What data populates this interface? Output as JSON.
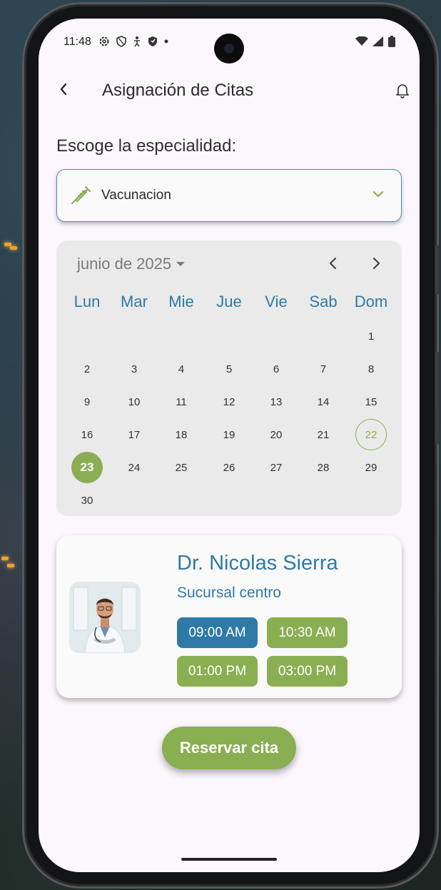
{
  "status_bar": {
    "time": "11:48",
    "icons": [
      "settings-icon",
      "shield-icon",
      "accessibility-icon",
      "shield-filled-icon",
      "dot-icon"
    ],
    "right_icons": [
      "wifi-icon",
      "signal-icon",
      "battery-icon"
    ]
  },
  "app_bar": {
    "title": "Asignación de Citas",
    "back_icon": "back-arrow-icon",
    "notification_icon": "bell-icon"
  },
  "specialty": {
    "label": "Escoge la especialidad:",
    "selected": "Vacunacion",
    "icon": "syringe-icon"
  },
  "calendar": {
    "month_label": "junio de 2025",
    "weekdays": [
      "Lun",
      "Mar",
      "Mie",
      "Jue",
      "Vie",
      "Sab",
      "Dom"
    ],
    "first_weekday_index": 6,
    "days_in_month": 30,
    "today": "22",
    "selected": "23",
    "days": [
      "1",
      "2",
      "3",
      "4",
      "5",
      "6",
      "7",
      "8",
      "9",
      "10",
      "11",
      "12",
      "13",
      "14",
      "15",
      "16",
      "17",
      "18",
      "19",
      "20",
      "21",
      "22",
      "23",
      "24",
      "25",
      "26",
      "27",
      "28",
      "29",
      "30"
    ]
  },
  "doctor": {
    "name": "Dr. Nicolas Sierra",
    "branch": "Sucursal centro",
    "slots": [
      "09:00 AM",
      "10:30 AM",
      "01:00 PM",
      "03:00 PM"
    ],
    "selected_slot": "09:00 AM"
  },
  "actions": {
    "reserve_label": "Reservar cita"
  },
  "colors": {
    "primary_blue": "#2f79a6",
    "accent_green": "#8aae52",
    "screen_bg": "#fcf6fd",
    "calendar_bg": "#eaeaea"
  }
}
